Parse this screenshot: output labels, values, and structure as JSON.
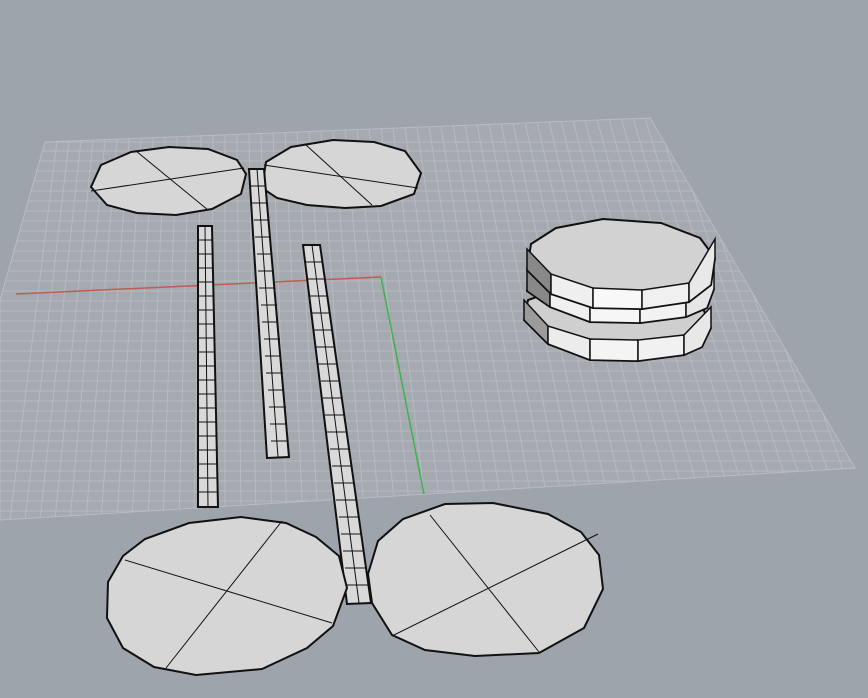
{
  "viewport": {
    "type": "perspective-3d-viewport",
    "background_color": "#9ea4ab",
    "grid_visible": true,
    "grid_color": "#b7bcc2",
    "x_axis_color": "#c45a55",
    "y_axis_color": "#41b14f",
    "object_fill": "#d7d7d7",
    "object_edge_color": "#111111"
  },
  "objects": [
    "upper-left-circle",
    "upper-right-circle",
    "left-slat",
    "center-slat",
    "right-slat",
    "lower-left-circle",
    "lower-right-circle",
    "stacked-disk"
  ]
}
